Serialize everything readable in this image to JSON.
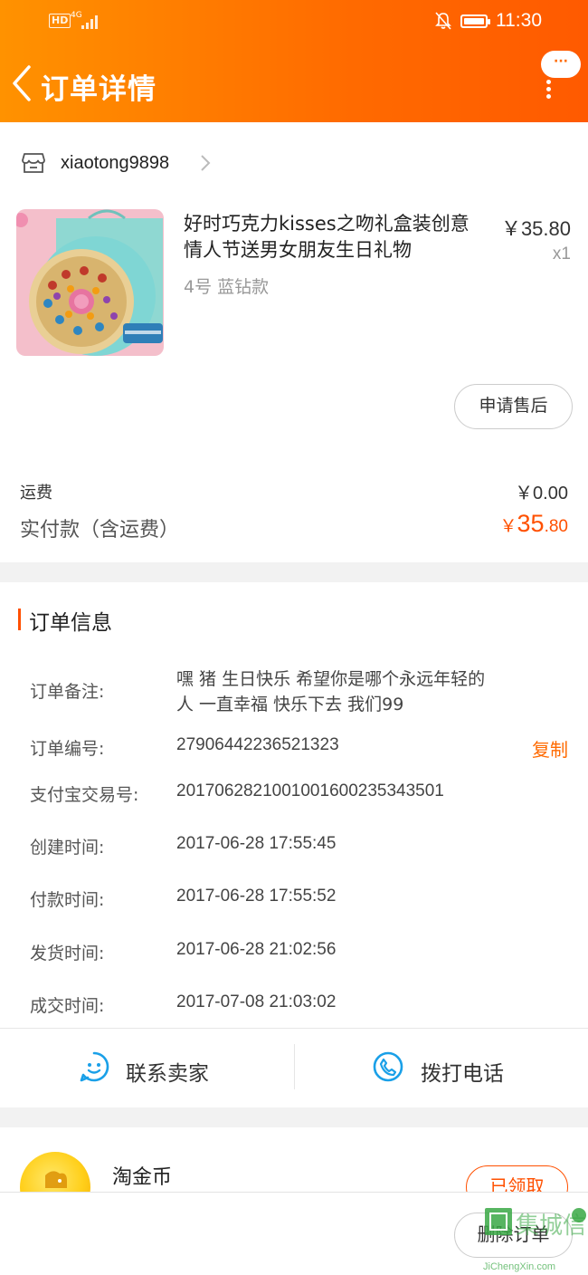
{
  "status_bar": {
    "hd": "HD",
    "network": "4G",
    "time": "11:30"
  },
  "header": {
    "title": "订单详情",
    "more_label": "···"
  },
  "store": {
    "name": "xiaotong9898"
  },
  "product": {
    "title": "好时巧克力kisses之吻礼盒装创意情人节送男女朋友生日礼物",
    "sku": "4号 蓝钻款",
    "price": "￥35.80",
    "qty": "x1",
    "after_sale_label": "申请售后"
  },
  "payment": {
    "shipping_label": "运费",
    "shipping_value": "￥0.00",
    "paid_label": "实付款（含运费）",
    "paid_currency": "￥",
    "paid_int": "35",
    "paid_dec": ".80"
  },
  "order_info": {
    "title": "订单信息",
    "copy_label": "复制",
    "rows": [
      {
        "label": "订单备注:",
        "value": "嘿 猪 生日快乐 希望你是哪个永远年轻的人 一直幸福 快乐下去 我们99"
      },
      {
        "label": "订单编号:",
        "value": "2790644223652132​3"
      },
      {
        "label": "支付宝交易号:",
        "value": "2017062821001001600235343501"
      },
      {
        "label": "创建时间:",
        "value": "2017-06-28 17:55:45"
      },
      {
        "label": "付款时间:",
        "value": "2017-06-28 17:55:52"
      },
      {
        "label": "发货时间:",
        "value": "2017-06-28 21:02:56"
      },
      {
        "label": "成交时间:",
        "value": "2017-07-08 21:03:02"
      }
    ]
  },
  "actions": {
    "contact_seller": "联系卖家",
    "call_phone": "拨打电话"
  },
  "coins": {
    "name": "淘金币",
    "claimed_label": "已领取"
  },
  "bottom_bar": {
    "delete_label": "删除订单"
  },
  "watermark": {
    "title": "集城信",
    "url": "JiChengXin.com"
  },
  "colors": {
    "accent": "#ff5000",
    "header_start": "#ff9200",
    "header_end": "#ff5a00",
    "link_blue": "#1aa0e8"
  }
}
